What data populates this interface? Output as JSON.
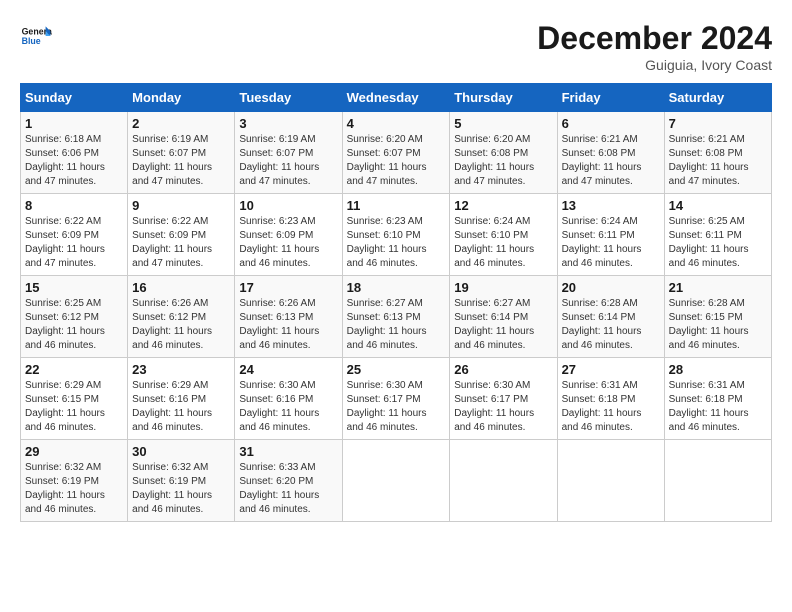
{
  "logo": {
    "text_general": "General",
    "text_blue": "Blue"
  },
  "header": {
    "month": "December 2024",
    "location": "Guiguia, Ivory Coast"
  },
  "weekdays": [
    "Sunday",
    "Monday",
    "Tuesday",
    "Wednesday",
    "Thursday",
    "Friday",
    "Saturday"
  ],
  "weeks": [
    [
      {
        "day": "1",
        "sunrise": "6:18 AM",
        "sunset": "6:06 PM",
        "daylight": "11 hours and 47 minutes."
      },
      {
        "day": "2",
        "sunrise": "6:19 AM",
        "sunset": "6:07 PM",
        "daylight": "11 hours and 47 minutes."
      },
      {
        "day": "3",
        "sunrise": "6:19 AM",
        "sunset": "6:07 PM",
        "daylight": "11 hours and 47 minutes."
      },
      {
        "day": "4",
        "sunrise": "6:20 AM",
        "sunset": "6:07 PM",
        "daylight": "11 hours and 47 minutes."
      },
      {
        "day": "5",
        "sunrise": "6:20 AM",
        "sunset": "6:08 PM",
        "daylight": "11 hours and 47 minutes."
      },
      {
        "day": "6",
        "sunrise": "6:21 AM",
        "sunset": "6:08 PM",
        "daylight": "11 hours and 47 minutes."
      },
      {
        "day": "7",
        "sunrise": "6:21 AM",
        "sunset": "6:08 PM",
        "daylight": "11 hours and 47 minutes."
      }
    ],
    [
      {
        "day": "8",
        "sunrise": "6:22 AM",
        "sunset": "6:09 PM",
        "daylight": "11 hours and 47 minutes."
      },
      {
        "day": "9",
        "sunrise": "6:22 AM",
        "sunset": "6:09 PM",
        "daylight": "11 hours and 47 minutes."
      },
      {
        "day": "10",
        "sunrise": "6:23 AM",
        "sunset": "6:09 PM",
        "daylight": "11 hours and 46 minutes."
      },
      {
        "day": "11",
        "sunrise": "6:23 AM",
        "sunset": "6:10 PM",
        "daylight": "11 hours and 46 minutes."
      },
      {
        "day": "12",
        "sunrise": "6:24 AM",
        "sunset": "6:10 PM",
        "daylight": "11 hours and 46 minutes."
      },
      {
        "day": "13",
        "sunrise": "6:24 AM",
        "sunset": "6:11 PM",
        "daylight": "11 hours and 46 minutes."
      },
      {
        "day": "14",
        "sunrise": "6:25 AM",
        "sunset": "6:11 PM",
        "daylight": "11 hours and 46 minutes."
      }
    ],
    [
      {
        "day": "15",
        "sunrise": "6:25 AM",
        "sunset": "6:12 PM",
        "daylight": "11 hours and 46 minutes."
      },
      {
        "day": "16",
        "sunrise": "6:26 AM",
        "sunset": "6:12 PM",
        "daylight": "11 hours and 46 minutes."
      },
      {
        "day": "17",
        "sunrise": "6:26 AM",
        "sunset": "6:13 PM",
        "daylight": "11 hours and 46 minutes."
      },
      {
        "day": "18",
        "sunrise": "6:27 AM",
        "sunset": "6:13 PM",
        "daylight": "11 hours and 46 minutes."
      },
      {
        "day": "19",
        "sunrise": "6:27 AM",
        "sunset": "6:14 PM",
        "daylight": "11 hours and 46 minutes."
      },
      {
        "day": "20",
        "sunrise": "6:28 AM",
        "sunset": "6:14 PM",
        "daylight": "11 hours and 46 minutes."
      },
      {
        "day": "21",
        "sunrise": "6:28 AM",
        "sunset": "6:15 PM",
        "daylight": "11 hours and 46 minutes."
      }
    ],
    [
      {
        "day": "22",
        "sunrise": "6:29 AM",
        "sunset": "6:15 PM",
        "daylight": "11 hours and 46 minutes."
      },
      {
        "day": "23",
        "sunrise": "6:29 AM",
        "sunset": "6:16 PM",
        "daylight": "11 hours and 46 minutes."
      },
      {
        "day": "24",
        "sunrise": "6:30 AM",
        "sunset": "6:16 PM",
        "daylight": "11 hours and 46 minutes."
      },
      {
        "day": "25",
        "sunrise": "6:30 AM",
        "sunset": "6:17 PM",
        "daylight": "11 hours and 46 minutes."
      },
      {
        "day": "26",
        "sunrise": "6:30 AM",
        "sunset": "6:17 PM",
        "daylight": "11 hours and 46 minutes."
      },
      {
        "day": "27",
        "sunrise": "6:31 AM",
        "sunset": "6:18 PM",
        "daylight": "11 hours and 46 minutes."
      },
      {
        "day": "28",
        "sunrise": "6:31 AM",
        "sunset": "6:18 PM",
        "daylight": "11 hours and 46 minutes."
      }
    ],
    [
      {
        "day": "29",
        "sunrise": "6:32 AM",
        "sunset": "6:19 PM",
        "daylight": "11 hours and 46 minutes."
      },
      {
        "day": "30",
        "sunrise": "6:32 AM",
        "sunset": "6:19 PM",
        "daylight": "11 hours and 46 minutes."
      },
      {
        "day": "31",
        "sunrise": "6:33 AM",
        "sunset": "6:20 PM",
        "daylight": "11 hours and 46 minutes."
      },
      null,
      null,
      null,
      null
    ]
  ]
}
